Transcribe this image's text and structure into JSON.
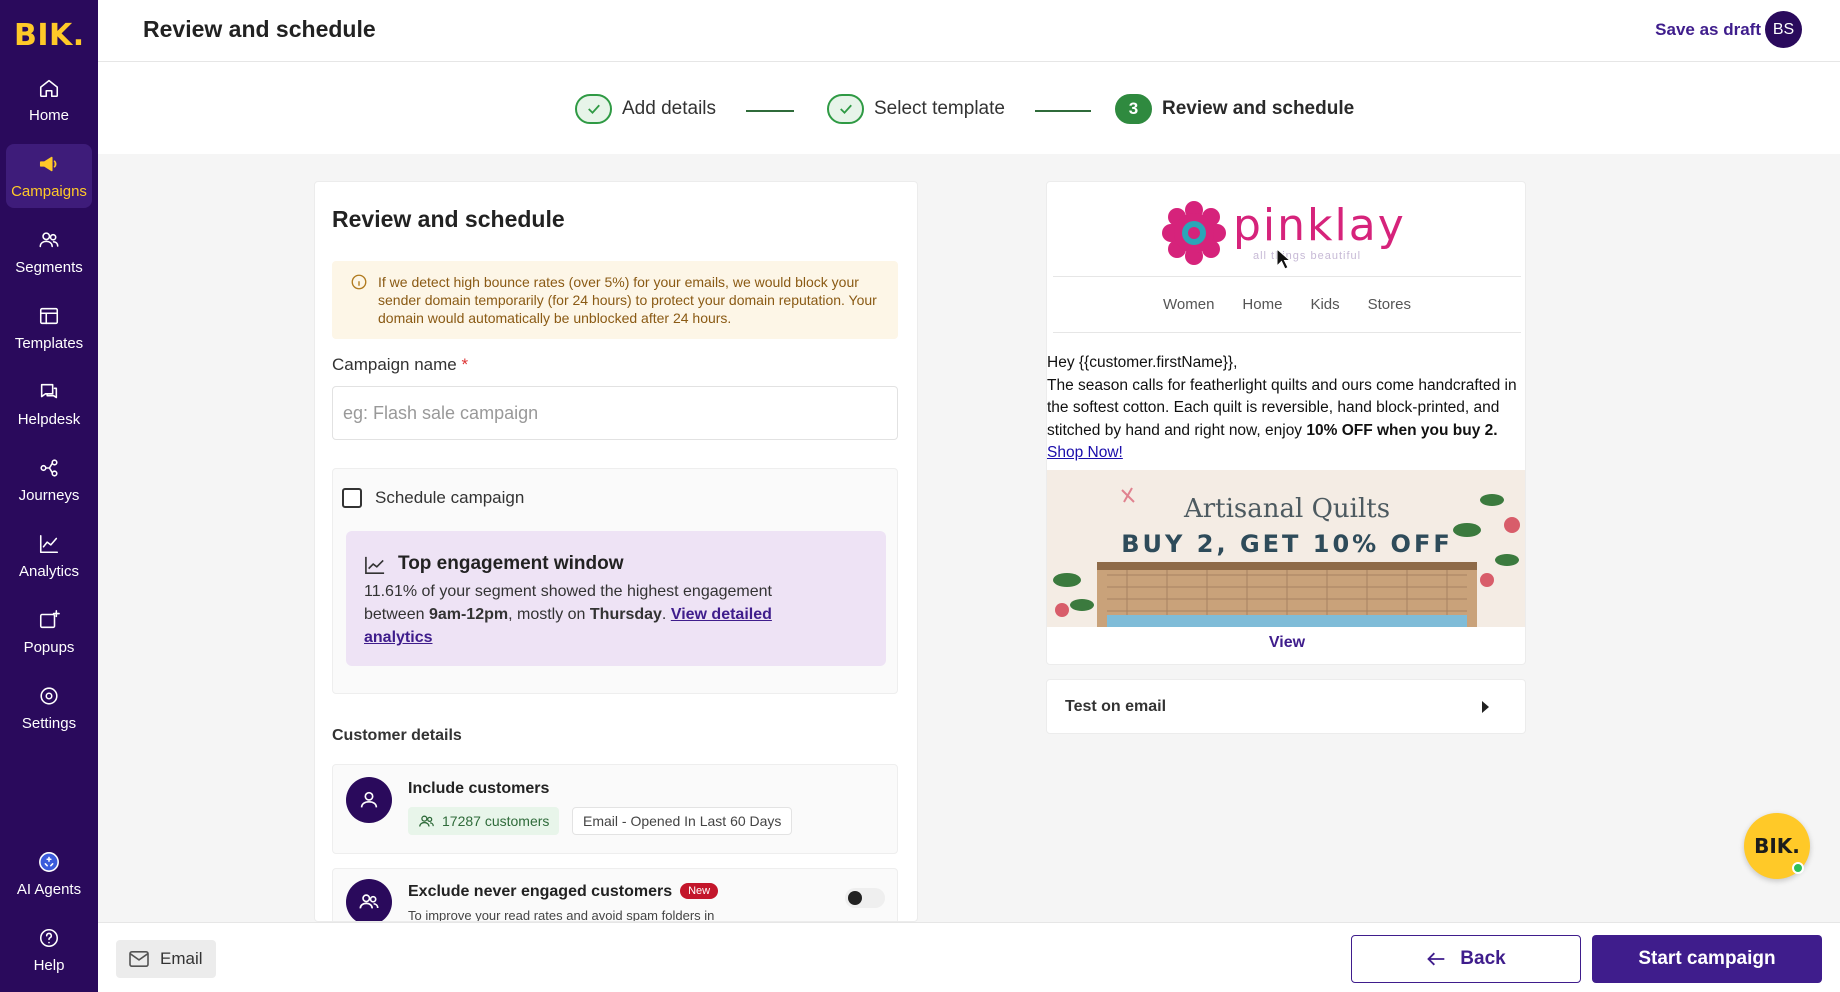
{
  "sidebar": {
    "logo": "BIK.",
    "items": [
      {
        "label": "Home",
        "icon": "home-icon",
        "active": false
      },
      {
        "label": "Campaigns",
        "icon": "megaphone-icon",
        "active": true
      },
      {
        "label": "Segments",
        "icon": "users-icon",
        "active": false
      },
      {
        "label": "Templates",
        "icon": "template-icon",
        "active": false
      },
      {
        "label": "Helpdesk",
        "icon": "chat-icon",
        "active": false
      },
      {
        "label": "Journeys",
        "icon": "journey-icon",
        "active": false
      },
      {
        "label": "Analytics",
        "icon": "analytics-icon",
        "active": false
      },
      {
        "label": "Popups",
        "icon": "popup-icon",
        "active": false
      },
      {
        "label": "Settings",
        "icon": "gear-icon",
        "active": false
      },
      {
        "label": "AI Agents",
        "icon": "ai-agent-icon",
        "active": false
      },
      {
        "label": "Help",
        "icon": "help-icon",
        "active": false
      }
    ]
  },
  "header": {
    "title": "Review and schedule",
    "save_draft": "Save as draft",
    "avatar_initials": "BS"
  },
  "stepper": {
    "steps": [
      {
        "label": "Add details",
        "state": "done"
      },
      {
        "label": "Select template",
        "state": "done"
      },
      {
        "number": "3",
        "label": "Review and schedule",
        "state": "current"
      }
    ]
  },
  "form": {
    "title": "Review and schedule",
    "warning": "If we detect high bounce rates (over 5%) for your emails, we would block your sender domain temporarily (for 24 hours) to protect your domain reputation. Your domain would automatically be unblocked after 24 hours.",
    "campaign_name_label": "Campaign name",
    "required_mark": "*",
    "campaign_name_value": "",
    "campaign_name_placeholder": "eg: Flash sale campaign",
    "schedule_label": "Schedule campaign",
    "schedule_checked": false,
    "engagement": {
      "title": "Top engagement window",
      "text_1": "11.61% of your segment showed the highest engagement between ",
      "time": "9am-12pm",
      "text_2": ", mostly on ",
      "day": "Thursday",
      "text_3": ". ",
      "link": "View detailed analytics"
    },
    "customer_details": {
      "title": "Customer details",
      "include": {
        "label": "Include customers",
        "count": "17287 customers",
        "segment": "Email - Opened In Last 60 Days"
      },
      "exclude": {
        "label": "Exclude never engaged customers",
        "badge": "New",
        "description": "To improve your read rates and avoid spam folders in",
        "enabled": false
      }
    }
  },
  "preview": {
    "brand": "pinklay",
    "tagline": "all things beautiful",
    "nav": [
      "Women",
      "Home",
      "Kids",
      "Stores"
    ],
    "greeting": "Hey {{customer.firstName}},",
    "body_1": "The season calls for featherlight quilts and ours come handcrafted in the softest cotton. Each quilt is reversible, hand block-printed, and stitched by hand and right now, enjoy ",
    "body_bold": "10% OFF when you buy 2.",
    "shop_link": "Shop Now!",
    "banner_title": "Artisanal Quilts",
    "banner_sub": "BUY 2, GET 10% OFF",
    "view_label": "View"
  },
  "test_email": {
    "label": "Test on email"
  },
  "footer": {
    "channel": "Email",
    "back": "Back",
    "start": "Start campaign"
  },
  "chat_widget": {
    "label": "BIK."
  },
  "colors": {
    "sidebar_bg": "#2a0a5c",
    "accent": "#3f1d8c",
    "brand_yellow": "#ffc928",
    "success_green": "#2f9a44",
    "brand_pink": "#d6237b"
  }
}
